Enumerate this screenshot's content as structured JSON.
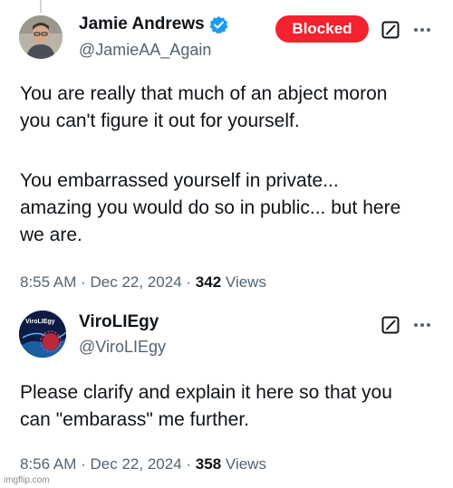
{
  "tweets": [
    {
      "author": {
        "display_name": "Jamie Andrews",
        "handle": "@JamieAA_Again",
        "verified": true
      },
      "blocked_label": "Blocked",
      "body_paragraphs": [
        [
          "You are really that much of an abject moron",
          "you can't figure it out for yourself."
        ],
        [
          "You embarrassed yourself in private...",
          "amazing you would do so in public... but here",
          "we are."
        ]
      ],
      "time": "8:55 AM",
      "date": "Dec 22, 2024",
      "views_count": "342",
      "views_label": "Views"
    },
    {
      "author": {
        "display_name": "ViroLIEgy",
        "handle": "@ViroLIEgy",
        "verified": false,
        "avatar_text": "ViroLIEgy"
      },
      "body_paragraphs": [
        [
          "Please clarify and explain it here so that you",
          "can \"embarass\" me further."
        ]
      ],
      "time": "8:56 AM",
      "date": "Dec 22, 2024",
      "views_count": "358",
      "views_label": "Views"
    }
  ],
  "separator": "·",
  "watermark": "imgflip.com",
  "colors": {
    "blocked_red": "#f4212e",
    "verified_blue": "#1d9bf0",
    "secondary_text": "#536471"
  },
  "icons": [
    "verified-badge-icon",
    "grok-icon",
    "more-options-icon"
  ]
}
